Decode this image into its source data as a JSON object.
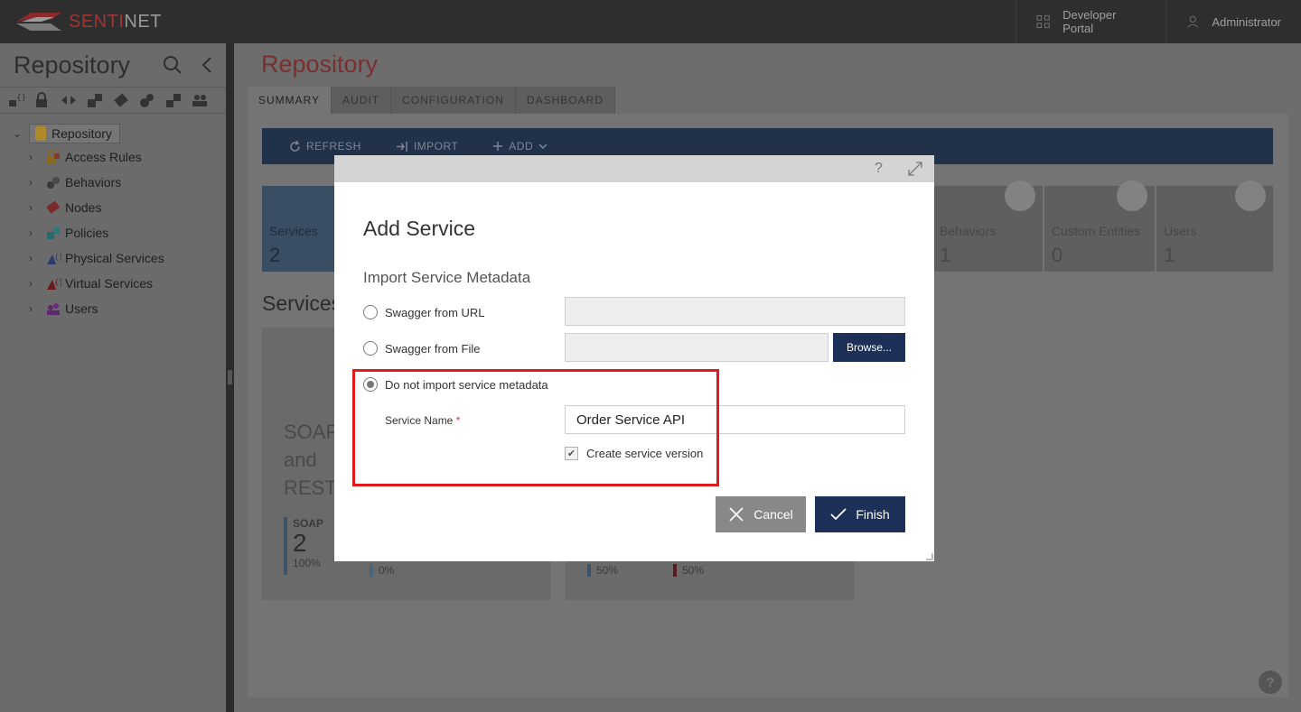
{
  "app": {
    "brand_a": "SENTI",
    "brand_b": "NET"
  },
  "topbar": {
    "developer_portal": "Developer Portal",
    "administrator": "Administrator"
  },
  "sidebar": {
    "title": "Repository",
    "root": "Repository",
    "items": [
      {
        "label": "Access Rules",
        "icon": "lock-icon"
      },
      {
        "label": "Behaviors",
        "icon": "behaviors-icon"
      },
      {
        "label": "Nodes",
        "icon": "nodes-icon"
      },
      {
        "label": "Policies",
        "icon": "policies-icon"
      },
      {
        "label": "Physical Services",
        "icon": "physical-services-icon"
      },
      {
        "label": "Virtual Services",
        "icon": "virtual-services-icon"
      },
      {
        "label": "Users",
        "icon": "users-icon"
      }
    ]
  },
  "main": {
    "title": "Repository",
    "tabs": [
      "SUMMARY",
      "AUDIT",
      "CONFIGURATION",
      "DASHBOARD"
    ],
    "toolbar": {
      "refresh": "REFRESH",
      "import": "IMPORT",
      "add": "ADD"
    },
    "tiles": [
      {
        "label": "Services",
        "value": "2"
      },
      {
        "label": "Behaviors",
        "value": "1"
      },
      {
        "label": "Custom Entities",
        "value": "0"
      },
      {
        "label": "Users",
        "value": "1"
      }
    ],
    "section_heading": "Services",
    "card1": {
      "line1": "SOAP",
      "line2": "and",
      "line3": "REST",
      "soap_label": "SOAP",
      "soap_value": "2",
      "soap_pct": "100%",
      "rest_pct": "0%"
    },
    "card2": {
      "pct_a": "50%",
      "pct_b": "50%"
    }
  },
  "dialog": {
    "title": "Add Service",
    "subtitle": "Import Service Metadata",
    "option_url": "Swagger from URL",
    "option_file": "Swagger from File",
    "option_none": "Do not import service metadata",
    "browse": "Browse...",
    "service_name_label": "Service Name",
    "required_mark": "*",
    "service_name_value": "Order Service API",
    "create_version": "Create service version",
    "cancel": "Cancel",
    "finish": "Finish",
    "help": "?"
  },
  "colors": {
    "accent_red": "#e0191f",
    "primary_blue": "#1d3058"
  }
}
